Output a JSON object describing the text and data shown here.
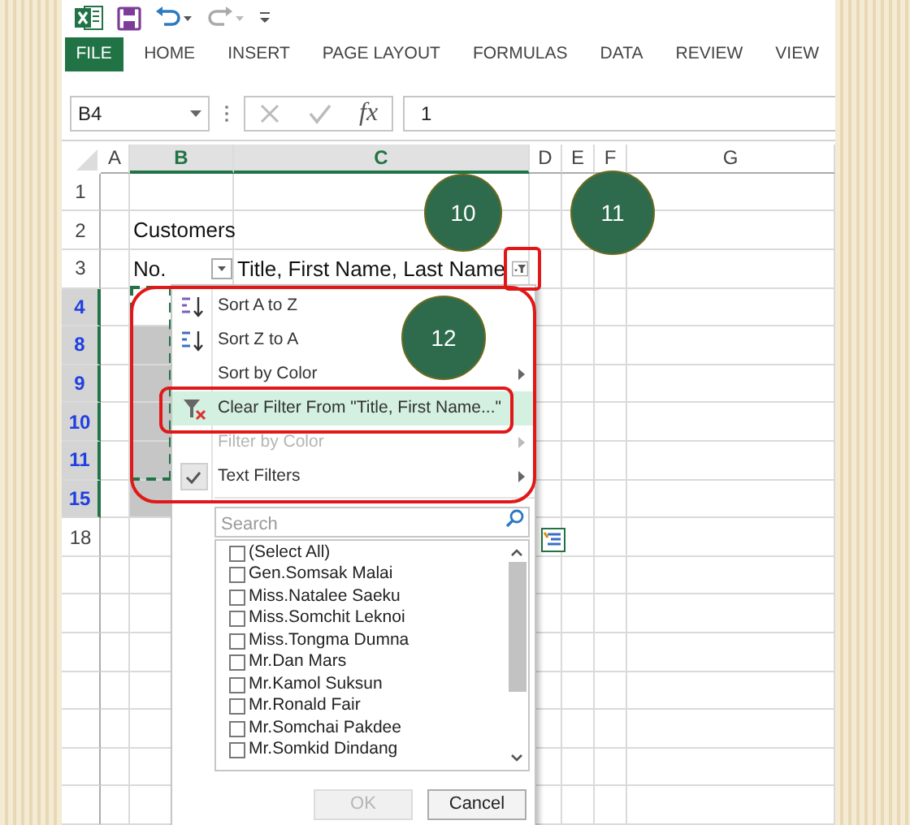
{
  "ribbon_tabs": [
    {
      "label": "FILE",
      "kind": "file"
    },
    {
      "label": "HOME",
      "kind": "tab"
    },
    {
      "label": "INSERT",
      "kind": "tab"
    },
    {
      "label": "PAGE LAYOUT",
      "kind": "tab"
    },
    {
      "label": "FORMULAS",
      "kind": "tab"
    },
    {
      "label": "DATA",
      "kind": "tab"
    },
    {
      "label": "REVIEW",
      "kind": "tab"
    },
    {
      "label": "VIEW",
      "kind": "tab"
    }
  ],
  "name_box": {
    "value": "B4"
  },
  "formula_bar": {
    "function_label": "fx",
    "value": "1"
  },
  "columns": [
    {
      "label": "A",
      "selected": false
    },
    {
      "label": "B",
      "selected": true
    },
    {
      "label": "C",
      "selected": true
    },
    {
      "label": "D",
      "selected": false
    },
    {
      "label": "E",
      "selected": false
    },
    {
      "label": "F",
      "selected": false
    },
    {
      "label": "G",
      "selected": false
    }
  ],
  "rows": [
    {
      "label": "1",
      "selected": false,
      "filtered": false
    },
    {
      "label": "2",
      "selected": false,
      "filtered": false,
      "b": "Customers"
    },
    {
      "label": "3",
      "selected": false,
      "filtered": false,
      "header": true,
      "b": "No.",
      "b_filter_active": false,
      "c": "Title, First Name, Last Name",
      "c_filter_active": true
    },
    {
      "label": "4",
      "selected": true,
      "filtered": true,
      "active": true
    },
    {
      "label": "8",
      "selected": true,
      "filtered": true,
      "active": false
    },
    {
      "label": "9",
      "selected": true,
      "filtered": true,
      "active": false
    },
    {
      "label": "10",
      "selected": true,
      "filtered": true,
      "active": false
    },
    {
      "label": "11",
      "selected": true,
      "filtered": true,
      "active": false
    },
    {
      "label": "15",
      "selected": true,
      "filtered": true,
      "active": false
    },
    {
      "label": "18",
      "selected": false,
      "filtered": false
    }
  ],
  "filter_menu": {
    "items": [
      {
        "label": "Sort A to Z",
        "kind": "sort-az",
        "submenu": false,
        "disabled": false,
        "highlighted": false
      },
      {
        "label": "Sort Z to A",
        "kind": "sort-za",
        "submenu": false,
        "disabled": false,
        "highlighted": false
      },
      {
        "label": "Sort by Color",
        "kind": "plain",
        "submenu": true,
        "disabled": false,
        "highlighted": false
      },
      {
        "label": "Clear Filter From \"Title, First Name...\"",
        "kind": "clear",
        "submenu": false,
        "disabled": false,
        "highlighted": true
      },
      {
        "label": "Filter by Color",
        "kind": "plain",
        "submenu": true,
        "disabled": true,
        "highlighted": false
      },
      {
        "label": "Text Filters",
        "kind": "check",
        "submenu": true,
        "disabled": false,
        "highlighted": false
      }
    ],
    "search": {
      "placeholder": "Search"
    },
    "values": [
      {
        "label": "(Select All)",
        "checked": false
      },
      {
        "label": "Gen.Somsak Malai",
        "checked": false
      },
      {
        "label": "Miss.Natalee Saeku",
        "checked": false
      },
      {
        "label": "Miss.Somchit Leknoi",
        "checked": false
      },
      {
        "label": "Miss.Tongma Dumna",
        "checked": false
      },
      {
        "label": "Mr.Dan Mars",
        "checked": false
      },
      {
        "label": "Mr.Kamol Suksun",
        "checked": false
      },
      {
        "label": "Mr.Ronald Fair",
        "checked": false
      },
      {
        "label": "Mr.Somchai Pakdee",
        "checked": false
      },
      {
        "label": "Mr.Somkid Dindang",
        "checked": false
      }
    ],
    "buttons": [
      {
        "label": "OK",
        "disabled": true
      },
      {
        "label": "Cancel",
        "disabled": false
      }
    ]
  },
  "callouts": [
    {
      "number": "10"
    },
    {
      "number": "11"
    },
    {
      "number": "12"
    }
  ]
}
